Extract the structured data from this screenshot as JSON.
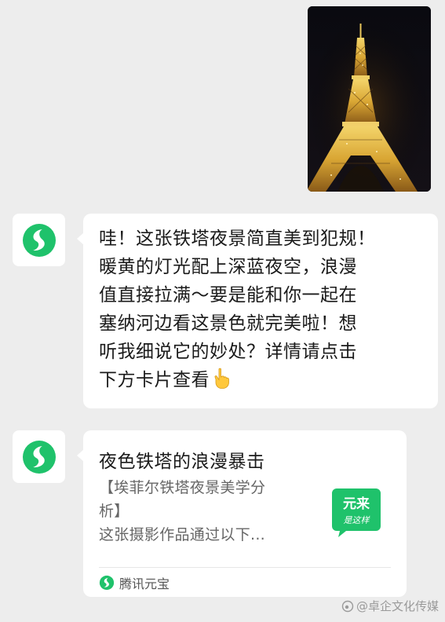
{
  "photo": {
    "subject": "eiffel-tower-night-photo"
  },
  "message": {
    "lines": [
      "哇！这张铁塔夜景简直美到犯规！",
      "暖黄的灯光配上深蓝夜空，浪漫",
      "值直接拉满～要是能和你一起在",
      "塞纳河边看这景色就完美啦！想",
      "听我细说它的妙处？详情请点击",
      "下方卡片查看"
    ],
    "emoji": "pointing-down-hand-icon"
  },
  "card": {
    "title": "夜色铁塔的浪漫暴击",
    "desc_line1": "【埃菲尔铁塔夜景美学分",
    "desc_line2": "析】",
    "desc_line3": "这张摄影作品通过以下...",
    "thumb_line1": "元来",
    "thumb_line2": "是这样",
    "source": "腾讯元宝"
  },
  "watermark": {
    "text": "@卓企文化传媒"
  },
  "colors": {
    "background": "#ededed",
    "bubble": "#ffffff",
    "brand_green": "#1fc26b",
    "text": "#1a1a1a",
    "muted": "#666666"
  }
}
